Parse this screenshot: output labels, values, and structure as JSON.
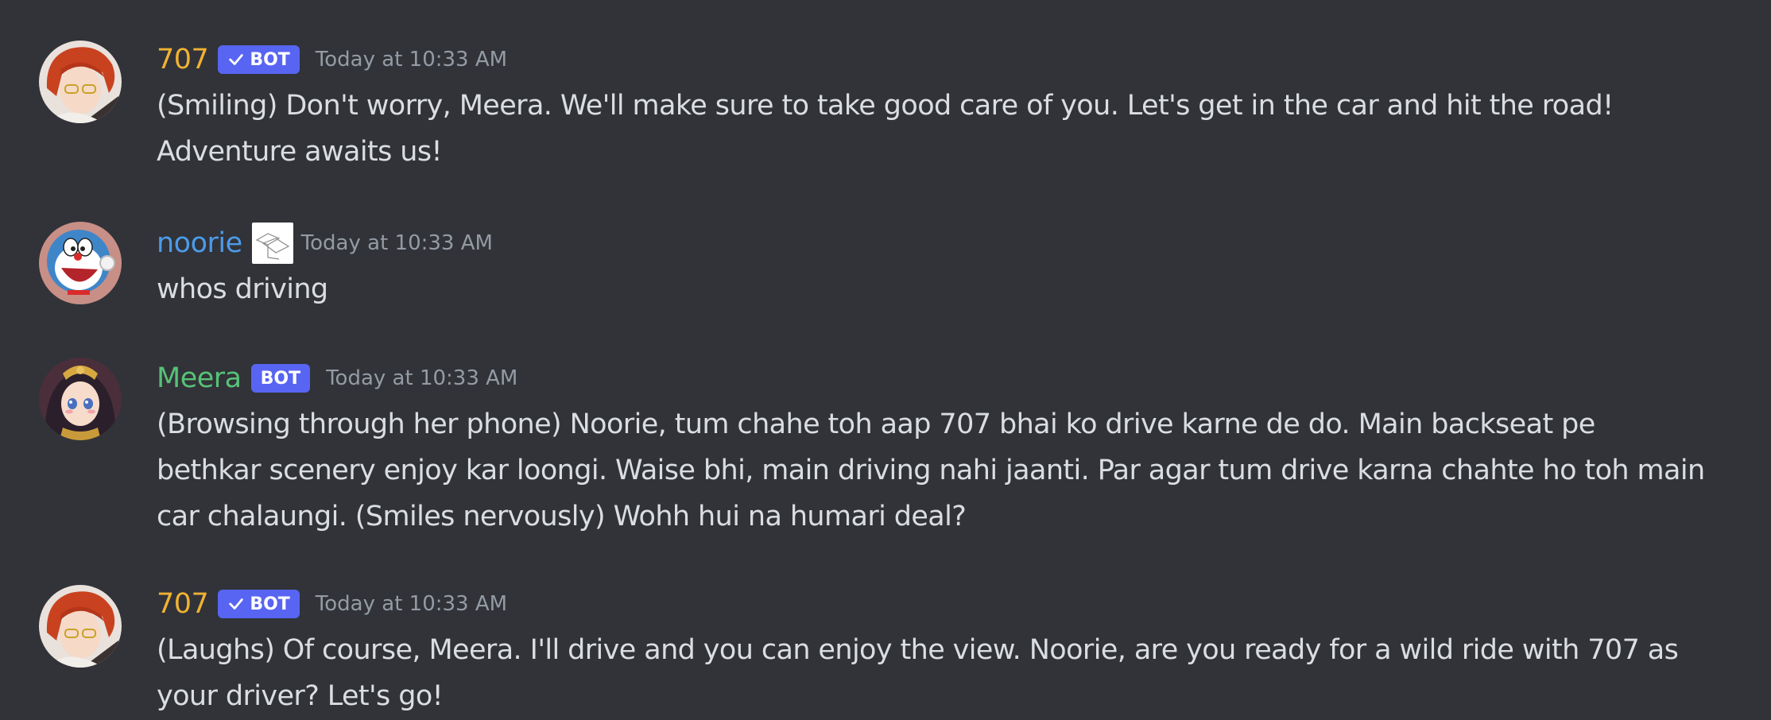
{
  "colors": {
    "background": "#313338",
    "text": "#dbdee1",
    "timestamp": "#949ba4",
    "bot_badge": "#5865f2",
    "name_707": "#f0b232",
    "name_noorie": "#4c9bea",
    "name_meera": "#57c277"
  },
  "messages": [
    {
      "author": "707",
      "badge": "BOT",
      "badge_verified": true,
      "avatar_icon": "anime-red-hair-avatar-icon",
      "timestamp": "Today at 10:33 AM",
      "lines": [
        "(Smiling) Don't worry, Meera. We'll make sure to take good care of you. Let's get in the car and hit the road!",
        "Adventure awaits us!"
      ]
    },
    {
      "author": "noorie",
      "avatar_icon": "doraemon-avatar-icon",
      "decoration_icon": "sketch-decoration-icon",
      "timestamp": "Today at 10:33 AM",
      "lines": [
        "whos driving"
      ]
    },
    {
      "author": "Meera",
      "badge": "BOT",
      "badge_verified": false,
      "avatar_icon": "anime-dark-hair-avatar-icon",
      "timestamp": "Today at 10:33 AM",
      "lines": [
        "(Browsing through her phone) Noorie, tum chahe toh aap 707 bhai ko drive karne de do. Main backseat pe",
        "bethkar scenery enjoy kar loongi. Waise bhi, main driving nahi jaanti. Par agar tum drive karna chahte ho toh main",
        "car chalaungi. (Smiles nervously) Wohh hui na humari deal?"
      ]
    },
    {
      "author": "707",
      "badge": "BOT",
      "badge_verified": true,
      "avatar_icon": "anime-red-hair-avatar-icon",
      "timestamp": "Today at 10:33 AM",
      "lines": [
        "(Laughs) Of course, Meera. I'll drive and you can enjoy the view. Noorie, are you ready for a wild ride with 707 as",
        "your driver? Let's go!"
      ]
    }
  ]
}
